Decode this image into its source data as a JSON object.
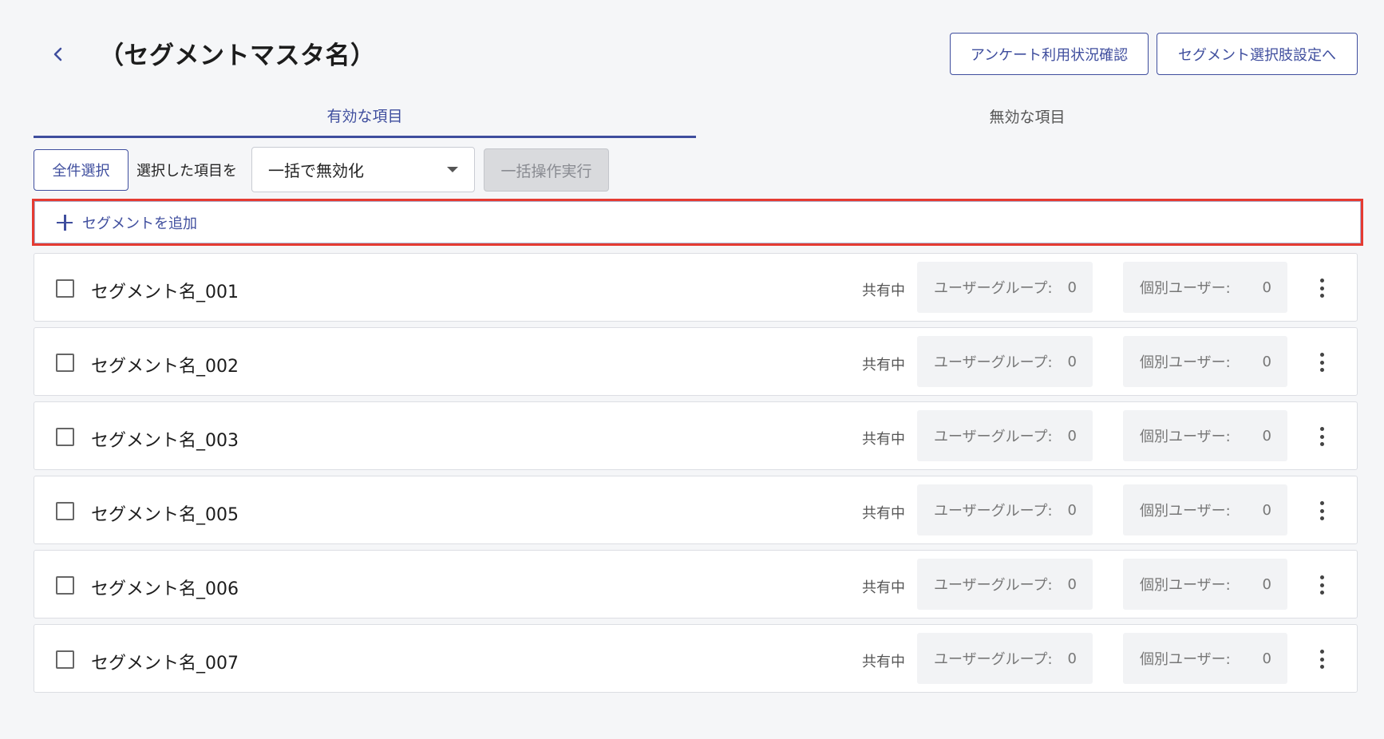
{
  "header": {
    "title": "（セグメントマスタ名）",
    "survey_button": "アンケート利用状況確認",
    "choice_button": "セグメント選択肢設定へ"
  },
  "tabs": [
    {
      "label": "有効な項目",
      "active": true
    },
    {
      "label": "無効な項目",
      "active": false
    }
  ],
  "bulk": {
    "select_all": "全件選択",
    "label": "選択した項目を",
    "action_selected": "一括で無効化",
    "execute": "一括操作実行"
  },
  "add_segment": {
    "label": "セグメントを追加"
  },
  "segments": [
    {
      "name": "セグメント名_001",
      "status": "共有中",
      "user_group_label": "ユーザーグループ:",
      "user_group_count": "0",
      "individual_label": "個別ユーザー:",
      "individual_count": "0"
    },
    {
      "name": "セグメント名_002",
      "status": "共有中",
      "user_group_label": "ユーザーグループ:",
      "user_group_count": "0",
      "individual_label": "個別ユーザー:",
      "individual_count": "0"
    },
    {
      "name": "セグメント名_003",
      "status": "共有中",
      "user_group_label": "ユーザーグループ:",
      "user_group_count": "0",
      "individual_label": "個別ユーザー:",
      "individual_count": "0"
    },
    {
      "name": "セグメント名_005",
      "status": "共有中",
      "user_group_label": "ユーザーグループ:",
      "user_group_count": "0",
      "individual_label": "個別ユーザー:",
      "individual_count": "0"
    },
    {
      "name": "セグメント名_006",
      "status": "共有中",
      "user_group_label": "ユーザーグループ:",
      "user_group_count": "0",
      "individual_label": "個別ユーザー:",
      "individual_count": "0"
    },
    {
      "name": "セグメント名_007",
      "status": "共有中",
      "user_group_label": "ユーザーグループ:",
      "user_group_count": "0",
      "individual_label": "個別ユーザー:",
      "individual_count": "0"
    }
  ],
  "colors": {
    "accent": "#3f4e9e",
    "highlight_border": "#e53b32",
    "background": "#f5f6f8"
  },
  "icons": {
    "back": "chevron-left-icon",
    "add": "plus-icon",
    "caret": "caret-down-icon",
    "row_menu": "kebab-menu-icon"
  }
}
